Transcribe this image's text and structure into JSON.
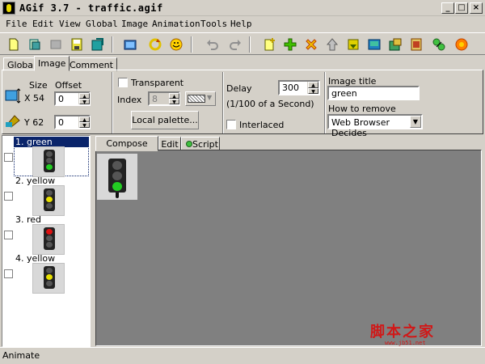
{
  "window": {
    "title": "AGif 3.7 - traffic.agif",
    "minimize_label": "_",
    "maximize_label": "□",
    "close_label": "×"
  },
  "menu": [
    "File",
    "Edit",
    "View",
    "Global",
    "Image",
    "Animation",
    "Tools",
    "Help"
  ],
  "toolbar": {
    "icons": [
      "new-icon",
      "open-icon",
      "close-file-icon",
      "save-icon",
      "save-as-icon",
      "preview-icon",
      "refresh-icon",
      "smiley-icon",
      "undo-icon",
      "redo-icon",
      "new-frame-icon",
      "add-icon",
      "delete-icon",
      "move-up-icon",
      "move-down-icon",
      "insert-image-icon",
      "export-icon",
      "export2-icon",
      "optimize-icon",
      "settings-icon"
    ]
  },
  "tabs": {
    "global": "Global",
    "image": "Image",
    "comment": "Comment"
  },
  "image_panel": {
    "size_label": "Size",
    "offset_label": "Offset",
    "x_label": "X",
    "x_size": "54",
    "x_offset": "0",
    "y_label": "Y",
    "y_size": "62",
    "y_offset": "0",
    "transparent_label": "Transparent",
    "index_label": "Index",
    "index_value": "8",
    "local_palette_label": "Local palette...",
    "delay_label": "Delay",
    "delay_value": "300",
    "delay_unit": "(1/100 of a Second)",
    "interlaced_label": "Interlaced",
    "image_title_label": "Image title",
    "image_title_value": "green",
    "how_to_remove_label": "How to remove",
    "how_to_remove_value": "Web Browser Decides"
  },
  "frames": [
    {
      "label": "1. green",
      "lamp": "green",
      "selected": true
    },
    {
      "label": "2. yellow",
      "lamp": "yellow",
      "selected": false
    },
    {
      "label": "3. red",
      "lamp": "red",
      "selected": false
    },
    {
      "label": "4. yellow",
      "lamp": "yellow",
      "selected": false
    }
  ],
  "subtabs": {
    "compose": "Compose",
    "edit": "Edit",
    "script": "Script"
  },
  "status": "Animate",
  "watermark": {
    "text": "脚本之家",
    "url": "www.jb51.net"
  },
  "colors": {
    "green_lamp": "#22cc22",
    "yellow_lamp": "#e8e000",
    "red_lamp": "#dd1111",
    "selection": "#0a246a"
  }
}
